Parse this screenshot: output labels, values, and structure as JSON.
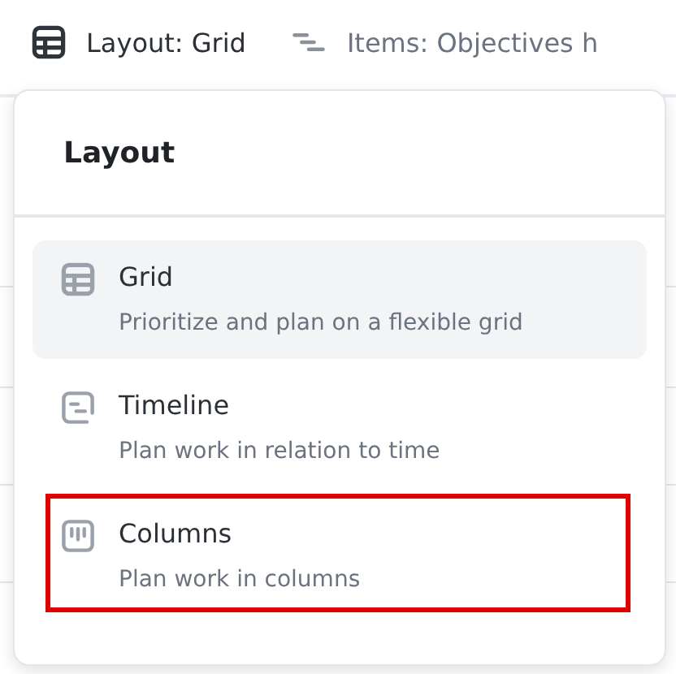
{
  "toolbar": [
    {
      "kind": "grid",
      "label": "Layout: Grid"
    },
    {
      "kind": "items",
      "label": "Items: Objectives h"
    }
  ],
  "menu": {
    "title": "Layout",
    "items": [
      {
        "kind": "grid",
        "title": "Grid",
        "description": "Prioritize and plan on a flexible grid",
        "selected": true,
        "annotated": false
      },
      {
        "kind": "timeline",
        "title": "Timeline",
        "description": "Plan work in relation to time",
        "selected": false,
        "annotated": false
      },
      {
        "kind": "columns",
        "title": "Columns",
        "description": "Plan work in columns",
        "selected": false,
        "annotated": true
      }
    ]
  }
}
